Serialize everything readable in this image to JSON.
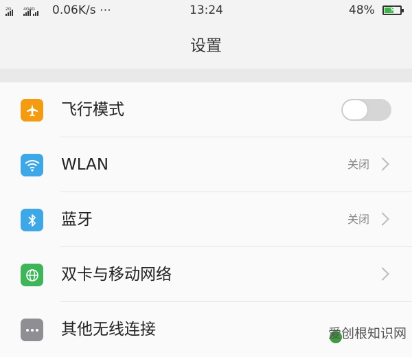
{
  "status_bar": {
    "signal": "2G 4G4G",
    "speed": "0.06K/s ⋯",
    "time": "13:24",
    "battery": "48%"
  },
  "header": {
    "title": "设置"
  },
  "settings": {
    "airplane": {
      "label": "飞行模式",
      "toggle_on": false,
      "icon": "airplane-icon",
      "color": "#f39c12"
    },
    "wlan": {
      "label": "WLAN",
      "value": "关闭",
      "icon": "wifi-icon",
      "color": "#3ea7e6"
    },
    "bluetooth": {
      "label": "蓝牙",
      "value": "关闭",
      "icon": "bluetooth-icon",
      "color": "#3ea7e6"
    },
    "mobile_network": {
      "label": "双卡与移动网络",
      "icon": "globe-icon",
      "color": "#3fb55a"
    },
    "other_wireless": {
      "label": "其他无线连接",
      "icon": "more-icon",
      "color": "#8e8e93"
    }
  },
  "watermark": {
    "text": "爱创根知识网"
  }
}
